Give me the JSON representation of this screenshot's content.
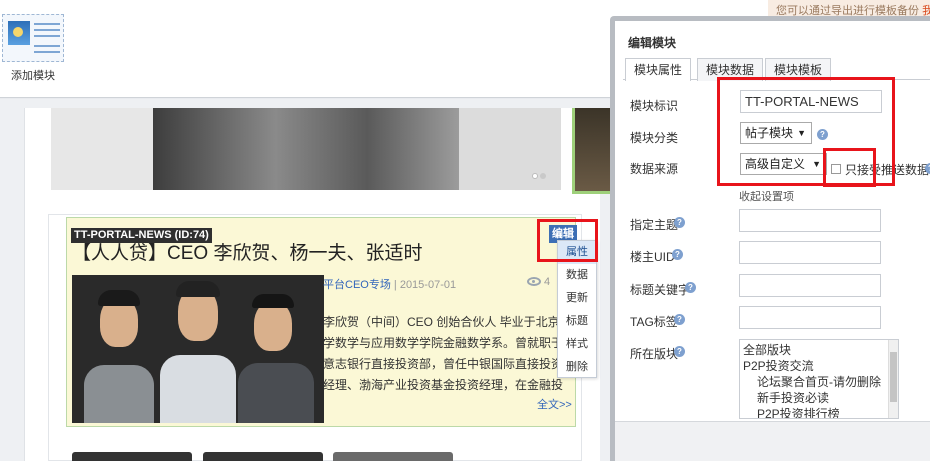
{
  "toolbar": {
    "add_module_label": "添加模块",
    "notice_text": "您可以通过导出进行模板备份",
    "notice_link": "我"
  },
  "news": {
    "block_id": "TT-PORTAL-NEWS (ID:74)",
    "title": "【人人贷】CEO 李欣贺、杨一夫、张适时",
    "category": "平台CEO专场",
    "date": "| 2015-07-01",
    "views": "4",
    "body_lines": [
      "李欣贺（中间）CEO 创始合伙人 毕业于北京",
      "学数学与应用数学学院金融数学系。曾就职于",
      "意志银行直接投资部，曾任中银国际直接投资",
      "经理、渤海产业投资基金投资经理，在金融投"
    ],
    "more": "全文>>"
  },
  "edit_popup": {
    "edit_label": "编辑",
    "menu": [
      "属性",
      "数据",
      "更新",
      "标题",
      "样式",
      "删除"
    ]
  },
  "dialog": {
    "title": "编辑模块",
    "tabs": [
      "模块属性",
      "模块数据",
      "模块模板"
    ],
    "fields": {
      "module_id_label": "模块标识",
      "module_id_value": "TT-PORTAL-NEWS",
      "category_label": "模块分类",
      "category_value": "帖子模块",
      "source_label": "数据来源",
      "source_value": "高级自定义",
      "push_only_label": "只接受推送数据",
      "collapse_link": "收起设置项",
      "topic_label": "指定主题",
      "author_uid_label": "楼主UID",
      "keyword_label": "标题关键字",
      "tag_label": "TAG标签",
      "forum_label": "所在版块"
    },
    "forum_options": [
      {
        "text": "全部版块",
        "indent": false
      },
      {
        "text": "P2P投资交流",
        "indent": false
      },
      {
        "text": "论坛聚合首页-请勿删除",
        "indent": true
      },
      {
        "text": "新手投资必读",
        "indent": true
      },
      {
        "text": "P2P投资排行榜",
        "indent": true
      }
    ]
  },
  "colors": {
    "highlight": "#e8141b",
    "accent": "#3d6fb5"
  }
}
